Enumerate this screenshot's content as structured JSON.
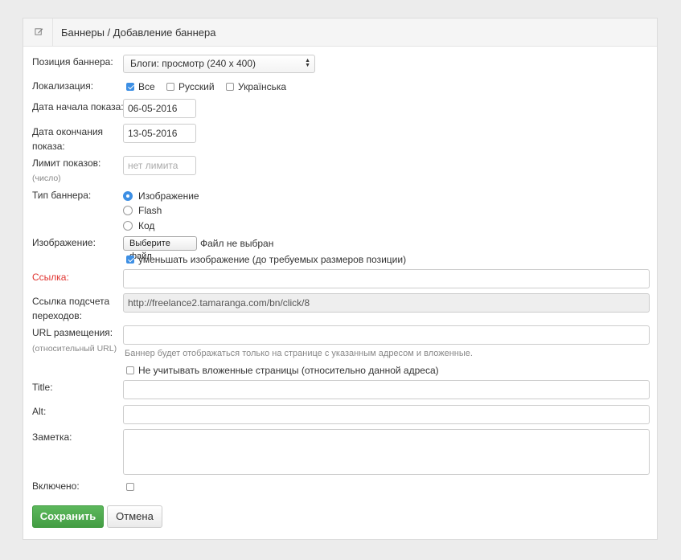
{
  "header": {
    "title": "Баннеры / Добавление баннера",
    "icon": "edit-icon"
  },
  "form": {
    "position": {
      "label": "Позиция баннера:",
      "value": "Блоги: просмотр (240 x 400)"
    },
    "locale": {
      "label": "Локализация:",
      "options": [
        {
          "label": "Все",
          "checked": true
        },
        {
          "label": "Русский",
          "checked": false
        },
        {
          "label": "Українська",
          "checked": false
        }
      ]
    },
    "start_date": {
      "label": "Дата начала показа:",
      "value": "06-05-2016"
    },
    "end_date": {
      "label_line1": "Дата окончания",
      "label_line2": "показа:",
      "value": "13-05-2016"
    },
    "limit": {
      "label": "Лимит показов:",
      "sublabel": "(число)",
      "placeholder": "нет лимита"
    },
    "type": {
      "label": "Тип баннера:",
      "options": [
        {
          "label": "Изображение",
          "checked": true
        },
        {
          "label": "Flash",
          "checked": false
        },
        {
          "label": "Код",
          "checked": false
        }
      ]
    },
    "image": {
      "label": "Изображение:",
      "button": "Выберите файл",
      "status": "Файл не выбран",
      "resize_label": "уменьшать изображение (до требуемых размеров позиции)",
      "resize_checked": true
    },
    "link": {
      "label": "Ссылка:",
      "value": ""
    },
    "click_link": {
      "label_line1": "Ссылка подсчета",
      "label_line2": "переходов:",
      "value": "http://freelance2.tamaranga.com/bn/click/8"
    },
    "url": {
      "label": "URL размещения:",
      "sublabel": "(относительный URL)",
      "value": "",
      "hint": "Баннер будет отображаться только на странице с указанным адресом и вложенные.",
      "ignore_label": "Не учитывать вложенные страницы (относительно данной адреса)",
      "ignore_checked": false
    },
    "title": {
      "label": "Title:",
      "value": ""
    },
    "alt": {
      "label": "Alt:",
      "value": ""
    },
    "note": {
      "label": "Заметка:",
      "value": ""
    },
    "enabled": {
      "label": "Включено:",
      "checked": false
    }
  },
  "actions": {
    "save": "Сохранить",
    "cancel": "Отмена"
  },
  "colors": {
    "accent": "#3d8fe4",
    "save": "#5cb85c",
    "required": "#e0332f"
  }
}
